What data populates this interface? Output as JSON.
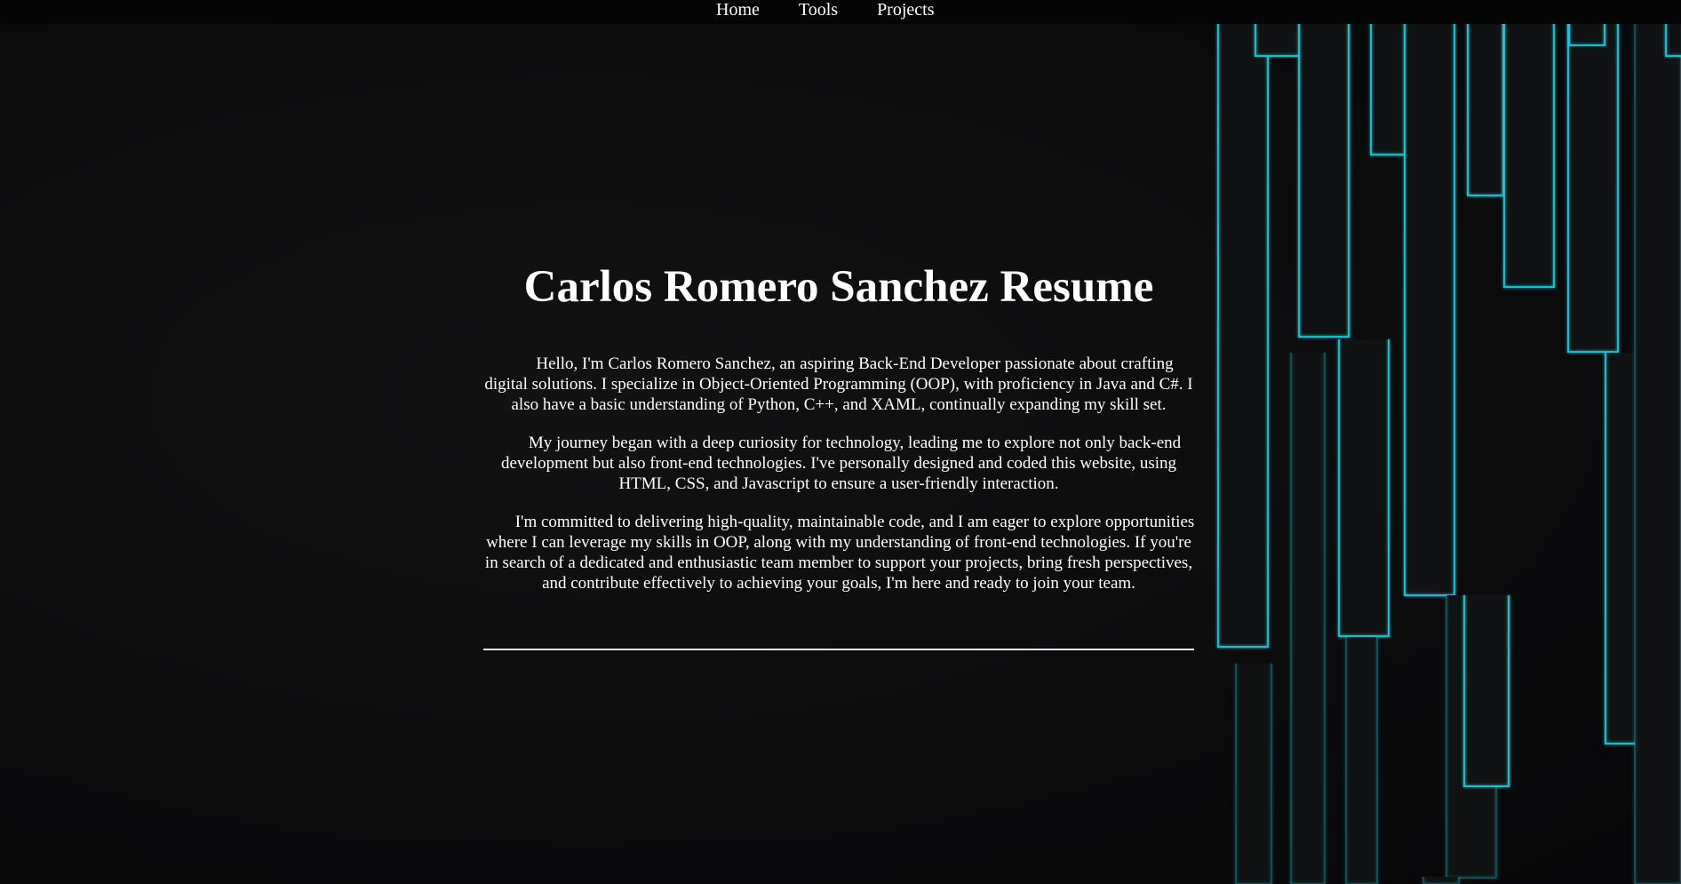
{
  "nav": {
    "items": [
      {
        "label": "Home"
      },
      {
        "label": "Tools"
      },
      {
        "label": "Projects"
      }
    ]
  },
  "main": {
    "title": "Carlos Romero Sanchez Resume",
    "paragraphs": [
      "Hello, I'm Carlos Romero Sanchez, an aspiring Back-End Developer passionate about crafting digital solutions. I specialize in Object-Oriented Programming (OOP), with proficiency in Java and C#. I also have a basic understanding of Python, C++, and XAML, continually expanding my skill set.",
      "My journey began with a deep curiosity for technology, leading me to explore not only back-end development but also front-end technologies. I've personally designed and coded this website, using HTML, CSS, and Javascript to ensure a user-friendly interaction.",
      "I'm committed to delivering high-quality, maintainable code, and I am eager to explore opportunities where I can leverage my skills in OOP, along with my understanding of front-end technologies. If you're in search of a dedicated and enthusiastic team member to support your projects, bring fresh perspectives, and contribute effectively to achieving your goals, I'm here and ready to join your team."
    ]
  },
  "colors": {
    "background": "#0b0b0c",
    "navbar": "#050505",
    "text": "#ffffff",
    "accent": "#14c8d8",
    "bar_fill": "#111213"
  }
}
